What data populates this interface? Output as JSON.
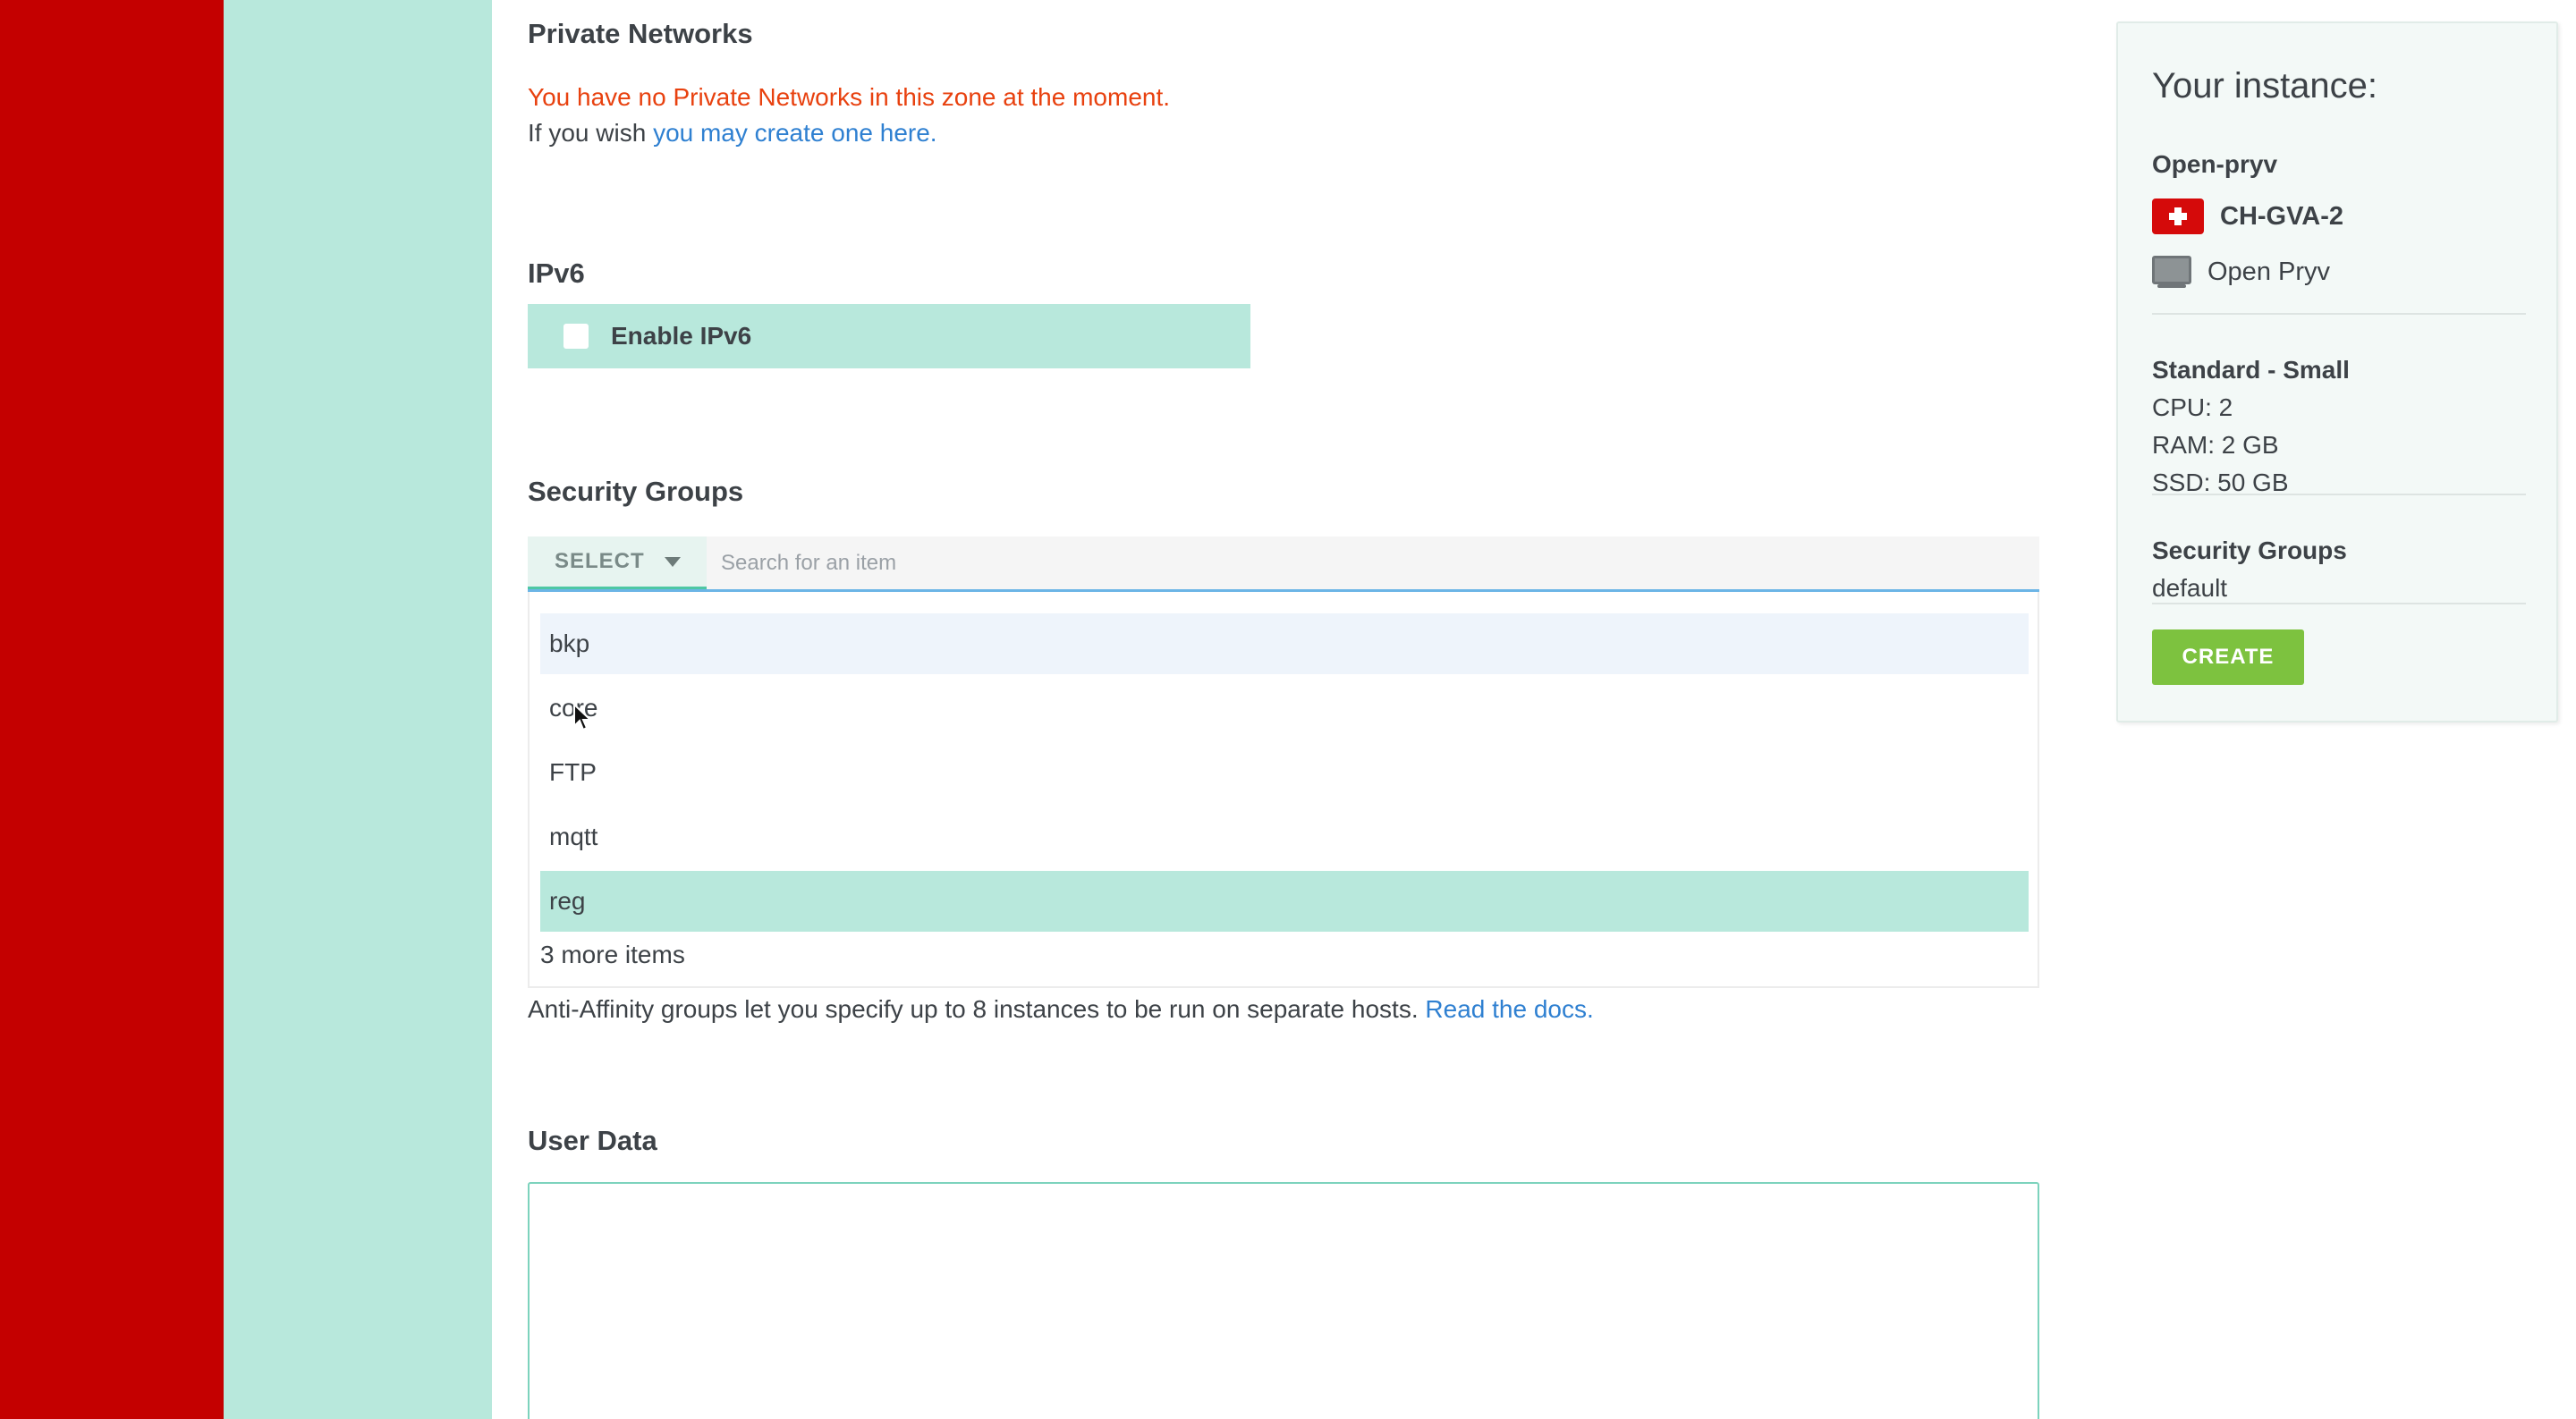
{
  "private_networks": {
    "heading": "Private Networks",
    "message": "You have no Private Networks in this zone at the moment.",
    "wish_prefix": "If you wish",
    "create_link": "you may create one here."
  },
  "ipv6": {
    "heading": "IPv6",
    "checkbox_label": "Enable IPv6",
    "checked": false
  },
  "security_groups": {
    "heading": "Security Groups",
    "select_label": "SELECT",
    "search_placeholder": "Search for an item",
    "options": [
      {
        "label": "bkp",
        "state": "hovered"
      },
      {
        "label": "core",
        "state": "normal"
      },
      {
        "label": "FTP",
        "state": "normal"
      },
      {
        "label": "mqtt",
        "state": "normal"
      },
      {
        "label": "reg",
        "state": "selected"
      }
    ],
    "more_items": "3 more items"
  },
  "anti_affinity": {
    "text": "Anti-Affinity groups let you specify up to 8 instances to be run on separate hosts.",
    "docs_link": "Read the docs."
  },
  "user_data": {
    "heading": "User Data",
    "value": ""
  },
  "summary": {
    "title": "Your instance:",
    "name": "Open-pryv",
    "zone": "CH-GVA-2",
    "zone_flag": "swiss-flag-icon",
    "template": "Open Pryv",
    "template_icon": "monitor-icon",
    "plan": "Standard - Small",
    "cpu": "CPU: 2",
    "ram": "RAM: 2 GB",
    "ssd": "SSD: 50 GB",
    "security_groups_title": "Security Groups",
    "security_groups_value": "default",
    "create_label": "CREATE"
  },
  "colors": {
    "brand_red": "#c40000",
    "mint": "#b8e8dc",
    "link_blue": "#2f80d1",
    "warning_orange": "#e8410f",
    "create_green": "#7dc23f"
  }
}
